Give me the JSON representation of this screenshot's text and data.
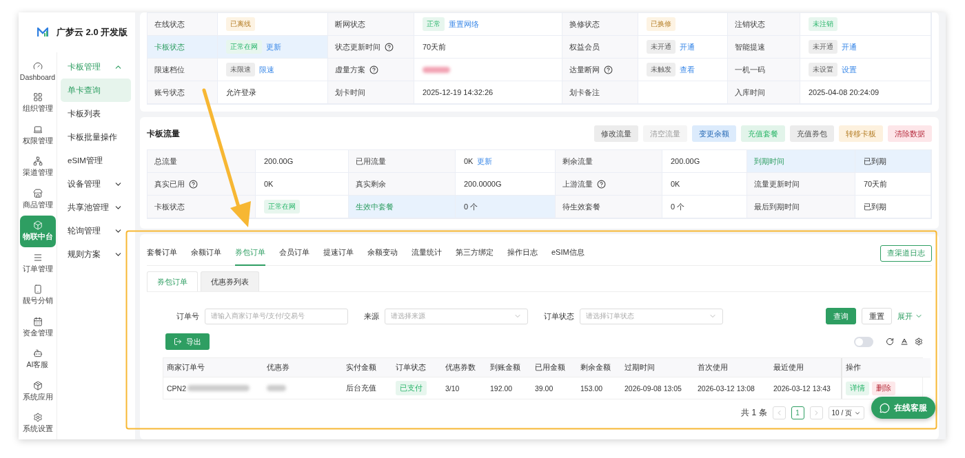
{
  "brand": {
    "name": "广梦云 2.0 开发版"
  },
  "rail": [
    {
      "label": "Dashboard",
      "selected": false
    },
    {
      "label": "组织管理",
      "selected": false
    },
    {
      "label": "权限管理",
      "selected": false
    },
    {
      "label": "渠道管理",
      "selected": false
    },
    {
      "label": "商品管理",
      "selected": false
    },
    {
      "label": "物联中台",
      "selected": true
    },
    {
      "label": "订单管理",
      "selected": false
    },
    {
      "label": "靓号分销",
      "selected": false
    },
    {
      "label": "资金管理",
      "selected": false
    },
    {
      "label": "AI客服",
      "selected": false
    },
    {
      "label": "系统应用",
      "selected": false
    },
    {
      "label": "系统设置",
      "selected": false
    }
  ],
  "menu": [
    {
      "label": "卡板管理",
      "expanded": true,
      "children": [
        {
          "label": "单卡查询",
          "selected": true
        },
        {
          "label": "卡板列表",
          "selected": false
        },
        {
          "label": "卡板批量操作",
          "selected": false
        },
        {
          "label": "eSIM管理",
          "selected": false
        }
      ]
    },
    {
      "label": "设备管理",
      "expanded": false
    },
    {
      "label": "共享池管理",
      "expanded": false
    },
    {
      "label": "轮询管理",
      "expanded": false
    },
    {
      "label": "规则方案",
      "expanded": false
    }
  ],
  "card_info": {
    "rows": [
      [
        {
          "label": "在线状态",
          "help": false,
          "highlighted": false,
          "tag": {
            "text": "已离线",
            "color": "#fdf3e3"
          }
        },
        {
          "label": "断网状态",
          "help": false,
          "highlighted": false,
          "tag": {
            "text": "正常",
            "color": "#e7f6ee"
          },
          "link": "重置网络"
        },
        {
          "label": "换修状态",
          "help": false,
          "highlighted": false,
          "tag": {
            "text": "已换修",
            "color": "#fdf3e3"
          }
        },
        {
          "label": "注销状态",
          "help": false,
          "highlighted": false,
          "tag": {
            "text": "未注销",
            "color": "#e7f6ee"
          }
        }
      ],
      [
        {
          "label": "卡板状态",
          "help": false,
          "highlighted": true,
          "tag": {
            "text": "正常在网",
            "color": "#e7f6ee"
          },
          "link": "更新"
        },
        {
          "label": "状态更新时间",
          "help": true,
          "highlighted": false,
          "value": "70天前"
        },
        {
          "label": "权益会员",
          "help": false,
          "highlighted": false,
          "tag": {
            "text": "未开通",
            "color": "#eeeeee"
          },
          "link": "开通"
        },
        {
          "label": "智能提速",
          "help": false,
          "highlighted": false,
          "tag": {
            "text": "未开通",
            "color": "#eeeeee"
          },
          "link": "开通"
        }
      ],
      [
        {
          "label": "限速档位",
          "help": false,
          "highlighted": false,
          "tag": {
            "text": "未限速",
            "color": "#eeeeee"
          },
          "link": "限速"
        },
        {
          "label": "虚量方案",
          "help": true,
          "highlighted": false,
          "blurred": true
        },
        {
          "label": "达量断网",
          "help": true,
          "highlighted": false,
          "tag": {
            "text": "未触发",
            "color": "#eeeeee"
          },
          "link": "查看"
        },
        {
          "label": "一机一码",
          "help": false,
          "highlighted": false,
          "tag": {
            "text": "未设置",
            "color": "#eeeeee"
          },
          "link": "设置"
        }
      ],
      [
        {
          "label": "账号状态",
          "help": false,
          "highlighted": false,
          "value": "允许登录"
        },
        {
          "label": "划卡时间",
          "help": false,
          "highlighted": false,
          "value": "2025-12-19 14:32:26"
        },
        {
          "label": "划卡备注",
          "help": false,
          "highlighted": false
        },
        {
          "label": "入库时间",
          "help": false,
          "highlighted": false,
          "value": "2025-04-08 20:24:09"
        }
      ]
    ]
  },
  "card_flow": {
    "title": "卡板流量",
    "actions": [
      {
        "label": "修改流量",
        "color": "#ececec"
      },
      {
        "label": "清空流量",
        "color": "#f5f5f5"
      },
      {
        "label": "变更余额",
        "color": "#dcebfc"
      },
      {
        "label": "充值套餐",
        "color": "#e2f4ea"
      },
      {
        "label": "充值券包",
        "color": "#ececec"
      },
      {
        "label": "转移卡板",
        "color": "#fdf1de"
      },
      {
        "label": "清除数据",
        "color": "#fde6e9"
      }
    ],
    "rows": [
      [
        {
          "label": "总流量",
          "help": false,
          "highlighted": false,
          "value": "200.00G"
        },
        {
          "label": "已用流量",
          "help": false,
          "highlighted": false,
          "value": "0K",
          "link": "更新"
        },
        {
          "label": "剩余流量",
          "help": false,
          "highlighted": false,
          "value": "200.00G"
        },
        {
          "label": "到期时间",
          "help": false,
          "highlighted": true,
          "value": "已到期"
        }
      ],
      [
        {
          "label": "真实已用",
          "help": true,
          "highlighted": false,
          "value": "0K"
        },
        {
          "label": "真实剩余",
          "help": false,
          "highlighted": false,
          "value": "200.0000G"
        },
        {
          "label": "上游流量",
          "help": true,
          "highlighted": false,
          "value": "0K"
        },
        {
          "label": "流量更新时间",
          "help": false,
          "highlighted": false,
          "value": "70天前"
        }
      ],
      [
        {
          "label": "卡板状态",
          "help": false,
          "highlighted": false,
          "tag": {
            "text": "正常在网",
            "color": "#e7f6ee"
          }
        },
        {
          "label": "生效中套餐",
          "help": false,
          "highlighted": true,
          "value": "0 个"
        },
        {
          "label": "待生效套餐",
          "help": false,
          "highlighted": false,
          "value": "0 个"
        },
        {
          "label": "最后到期时间",
          "help": false,
          "highlighted": false,
          "value": "已到期"
        }
      ]
    ]
  },
  "orders": {
    "tabs": [
      {
        "label": "套餐订单",
        "selected": false
      },
      {
        "label": "余额订单",
        "selected": false
      },
      {
        "label": "券包订单",
        "selected": true
      },
      {
        "label": "会员订单",
        "selected": false
      },
      {
        "label": "提速订单",
        "selected": false
      },
      {
        "label": "余额变动",
        "selected": false
      },
      {
        "label": "流量统计",
        "selected": false
      },
      {
        "label": "第三方绑定",
        "selected": false
      },
      {
        "label": "操作日志",
        "selected": false
      },
      {
        "label": "eSIM信息",
        "selected": false
      }
    ],
    "log_button": "查渠道日志",
    "subtabs": [
      {
        "label": "券包订单",
        "selected": true
      },
      {
        "label": "优惠券列表",
        "selected": false
      }
    ],
    "filters": [
      {
        "label": "订单号",
        "kind": "input",
        "placeholder": "请输入商家订单号/支付/交易号"
      },
      {
        "label": "来源",
        "kind": "select",
        "placeholder": "请选择来源"
      },
      {
        "label": "订单状态",
        "kind": "select",
        "placeholder": "请选择订单状态"
      }
    ],
    "search_button": "查询",
    "reset_button": "重置",
    "expand_link": "展开",
    "export_button": "导出",
    "toggle": {
      "on": false
    },
    "columns": [
      "商家订单号",
      "优惠券",
      "实付金额",
      "订单状态",
      "优惠券数",
      "到账金额",
      "已用金额",
      "剩余金额",
      "过期时间",
      "首次使用",
      "最近使用",
      "操作"
    ],
    "rows": [
      {
        "order_no": "CPN2",
        "order_no_blurred": true,
        "coupon_blurred": true,
        "paid": "后台充值",
        "status": "已支付",
        "count": "3/10",
        "received": "192.00",
        "used": "39.00",
        "remaining": "153.00",
        "expires": "2026-09-08 13:05",
        "first_use": "2026-03-12 13:08",
        "last_use": "2026-03-12 13:43",
        "actions": [
          {
            "label": "详情",
            "color": "#e7f6ee"
          },
          {
            "label": "删除",
            "color": "#fde8ea"
          }
        ]
      }
    ],
    "pagination": {
      "total": "共 1 条",
      "pages": [
        {
          "label": "1",
          "selected": true
        }
      ],
      "page_size": "10 / 页"
    }
  },
  "chat_button": "在线客服"
}
